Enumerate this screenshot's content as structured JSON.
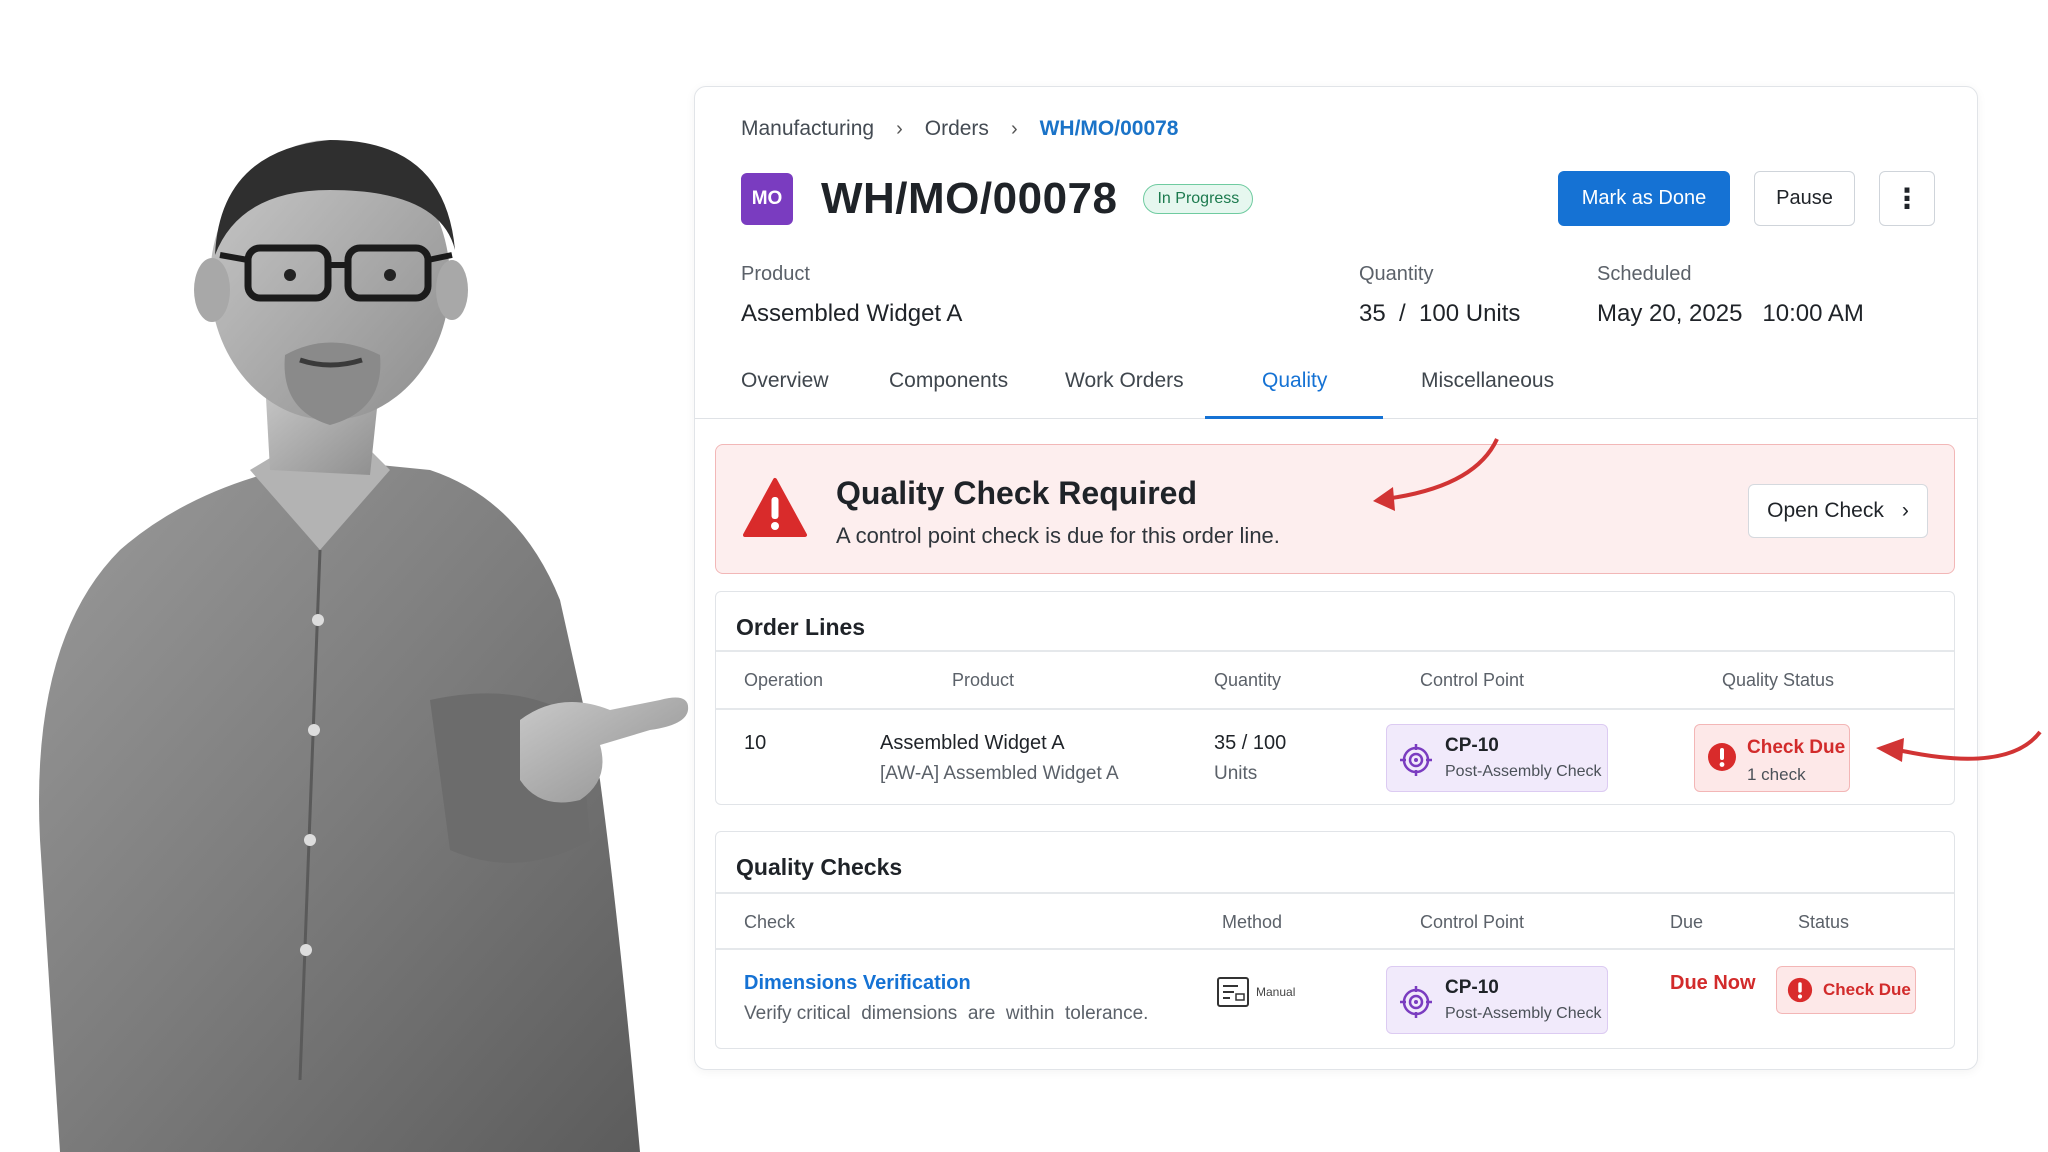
{
  "breadcrumb": {
    "items": [
      "Manufacturing",
      "Orders"
    ],
    "current": "WH/MO/00078"
  },
  "header": {
    "badge": "MO",
    "title": "WH/MO/00078",
    "status": "In Progress"
  },
  "actions": {
    "primary": "Mark as Done",
    "secondary": "Pause",
    "more": "⋮"
  },
  "meta": {
    "product_label": "Product",
    "product_value": "Assembled Widget A",
    "quantity_label": "Quantity",
    "quantity_value": "35  /  100 Units",
    "scheduled_label": "Scheduled",
    "scheduled_value": "May 20, 2025   10:00 AM"
  },
  "tabs": [
    "Overview",
    "Components",
    "Work Orders",
    "Quality",
    "Miscellaneous"
  ],
  "active_tab": "Quality",
  "alert": {
    "title": "Quality Check Required",
    "text": "A control point check is due for this order line.",
    "button": "Open Check"
  },
  "order_lines": {
    "title": "Order Lines",
    "columns": [
      "Operation",
      "Product",
      "Quantity",
      "Control Point",
      "Quality Status"
    ],
    "row": {
      "operation": "10",
      "product": "Assembled Widget A",
      "product_sub": "[AW-A] Assembled Widget A",
      "quantity": "35 / 100",
      "quantity_sub": "Units",
      "cp_code": "CP-10",
      "cp_name": "Post-Assembly Check",
      "status": "Check Due",
      "status_sub": "1 check"
    }
  },
  "quality_checks": {
    "title": "Quality Checks",
    "columns": [
      "Check",
      "Method",
      "Control Point",
      "Due",
      "Status"
    ],
    "row": {
      "check": "Dimensions Verification",
      "check_sub": "Verify critical  dimensions  are  within  tolerance.",
      "method": "Manual",
      "cp_code": "CP-10",
      "cp_name": "Post-Assembly Check",
      "due": "Due Now",
      "status": "Check Due"
    }
  },
  "colors": {
    "accent": "#1572d4",
    "danger": "#d22b2b",
    "badge": "#7a3cc0",
    "success": "#1c7a4e"
  }
}
